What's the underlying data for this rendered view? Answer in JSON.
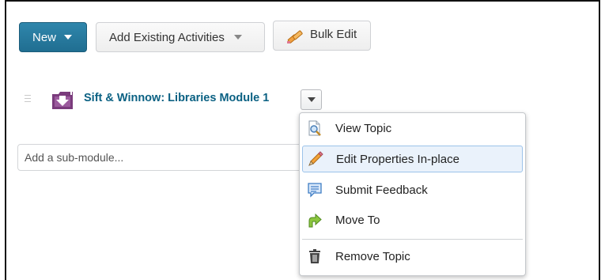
{
  "toolbar": {
    "new_label": "New",
    "add_existing_label": "Add Existing Activities",
    "bulk_edit_label": "Bulk Edit"
  },
  "module": {
    "title": "Sift & Winnow: Libraries Module 1"
  },
  "sub_module": {
    "placeholder": "Add a sub-module..."
  },
  "menu": {
    "items": [
      {
        "label": "View Topic",
        "icon": "view-topic-icon"
      },
      {
        "label": "Edit Properties In-place",
        "icon": "pencil-icon"
      },
      {
        "label": "Submit Feedback",
        "icon": "feedback-icon"
      },
      {
        "label": "Move To",
        "icon": "move-arrow-icon"
      },
      {
        "label": "Remove Topic",
        "icon": "trash-icon"
      }
    ],
    "active_index": 1
  },
  "colors": {
    "primary": "#206e91",
    "link": "#0b6183",
    "module_icon": "#7a3b7c",
    "highlight": "#eaf2fb"
  }
}
